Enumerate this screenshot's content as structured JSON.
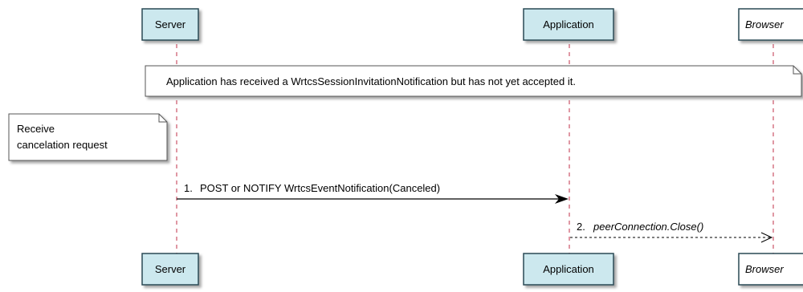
{
  "participants": {
    "server": {
      "label": "Server"
    },
    "application": {
      "label": "Application"
    },
    "browser": {
      "label": "Browser"
    }
  },
  "notes": {
    "state_note": "Application has received a WrtcsSessionInvitationNotification but has not yet accepted it.",
    "receive_note_line1": "Receive",
    "receive_note_line2": "cancelation request"
  },
  "messages": [
    {
      "number": "1.",
      "label": "POST or NOTIFY WrtcsEventNotification(Canceled)",
      "from": "server",
      "to": "application",
      "style": "solid"
    },
    {
      "number": "2.",
      "label": "peerConnection.Close()",
      "from": "application",
      "to": "browser",
      "style": "dashed"
    }
  ],
  "colors": {
    "participant_fill": "#CCE8EE",
    "participant_border": "#2A4A55",
    "browser_fill": "#FFFFFF",
    "note_fill": "#FFFFFF",
    "note_border": "#555555",
    "lifeline": "#C0304A",
    "arrow": "#000000"
  }
}
